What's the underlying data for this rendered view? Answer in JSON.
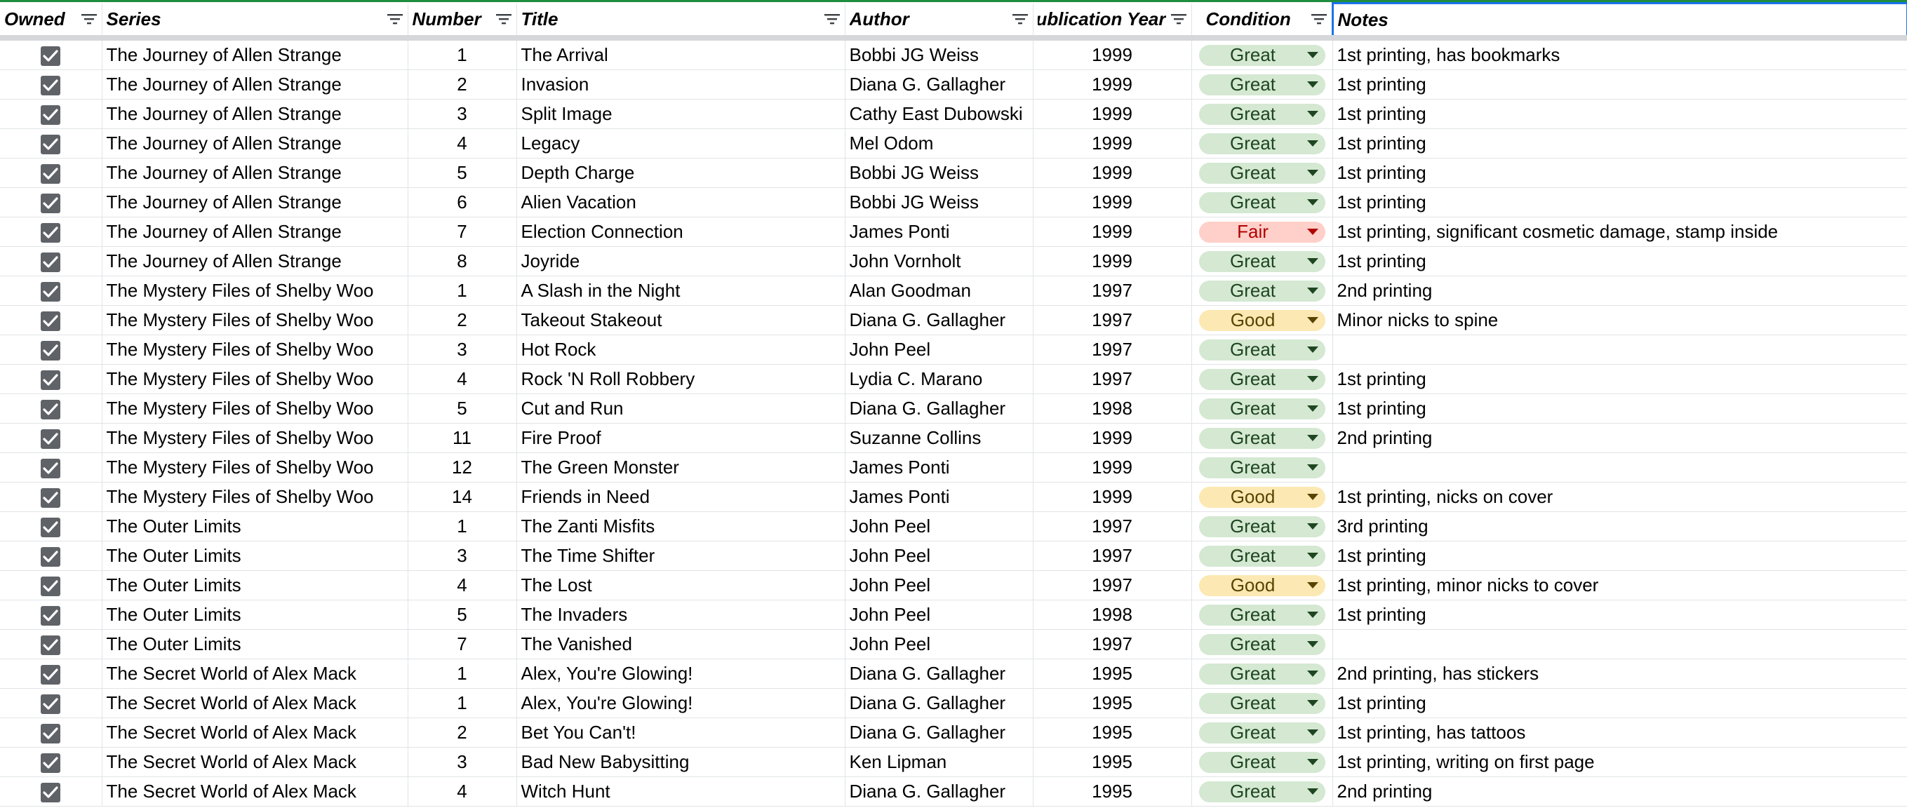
{
  "headers": {
    "owned": "Owned",
    "series": "Series",
    "number": "Number",
    "title": "Title",
    "author": "Author",
    "year": "Publication Year",
    "condition": "Condition",
    "notes": "Notes"
  },
  "condition_colors": {
    "Great": {
      "bg": "#d4e8d2",
      "fg": "#1e4620"
    },
    "Good": {
      "bg": "#fce8b2",
      "fg": "#594300"
    },
    "Fair": {
      "bg": "#ffcfc9",
      "fg": "#b10202"
    }
  },
  "rows": [
    {
      "owned": true,
      "series": "The Journey of Allen Strange",
      "number": "1",
      "title": "The Arrival",
      "author": "Bobbi JG Weiss",
      "year": "1999",
      "condition": "Great",
      "notes": "1st printing, has bookmarks"
    },
    {
      "owned": true,
      "series": "The Journey of Allen Strange",
      "number": "2",
      "title": "Invasion",
      "author": "Diana G. Gallagher",
      "year": "1999",
      "condition": "Great",
      "notes": "1st printing"
    },
    {
      "owned": true,
      "series": "The Journey of Allen Strange",
      "number": "3",
      "title": "Split Image",
      "author": "Cathy East Dubowski",
      "year": "1999",
      "condition": "Great",
      "notes": "1st printing"
    },
    {
      "owned": true,
      "series": "The Journey of Allen Strange",
      "number": "4",
      "title": "Legacy",
      "author": "Mel Odom",
      "year": "1999",
      "condition": "Great",
      "notes": "1st printing"
    },
    {
      "owned": true,
      "series": "The Journey of Allen Strange",
      "number": "5",
      "title": "Depth Charge",
      "author": "Bobbi JG Weiss",
      "year": "1999",
      "condition": "Great",
      "notes": "1st printing"
    },
    {
      "owned": true,
      "series": "The Journey of Allen Strange",
      "number": "6",
      "title": "Alien Vacation",
      "author": "Bobbi JG Weiss",
      "year": "1999",
      "condition": "Great",
      "notes": "1st printing"
    },
    {
      "owned": true,
      "series": "The Journey of Allen Strange",
      "number": "7",
      "title": "Election Connection",
      "author": "James Ponti",
      "year": "1999",
      "condition": "Fair",
      "notes": "1st printing, significant cosmetic damage, stamp inside"
    },
    {
      "owned": true,
      "series": "The Journey of Allen Strange",
      "number": "8",
      "title": "Joyride",
      "author": "John Vornholt",
      "year": "1999",
      "condition": "Great",
      "notes": "1st printing"
    },
    {
      "owned": true,
      "series": "The Mystery Files of Shelby Woo",
      "number": "1",
      "title": "A Slash in the Night",
      "author": "Alan Goodman",
      "year": "1997",
      "condition": "Great",
      "notes": "2nd printing"
    },
    {
      "owned": true,
      "series": "The Mystery Files of Shelby Woo",
      "number": "2",
      "title": "Takeout Stakeout",
      "author": "Diana G. Gallagher",
      "year": "1997",
      "condition": "Good",
      "notes": "Minor nicks to spine"
    },
    {
      "owned": true,
      "series": "The Mystery Files of Shelby Woo",
      "number": "3",
      "title": "Hot Rock",
      "author": "John Peel",
      "year": "1997",
      "condition": "Great",
      "notes": ""
    },
    {
      "owned": true,
      "series": "The Mystery Files of Shelby Woo",
      "number": "4",
      "title": "Rock 'N Roll Robbery",
      "author": "Lydia C. Marano",
      "year": "1997",
      "condition": "Great",
      "notes": "1st printing"
    },
    {
      "owned": true,
      "series": "The Mystery Files of Shelby Woo",
      "number": "5",
      "title": "Cut and Run",
      "author": "Diana G. Gallagher",
      "year": "1998",
      "condition": "Great",
      "notes": "1st printing"
    },
    {
      "owned": true,
      "series": "The Mystery Files of Shelby Woo",
      "number": "11",
      "title": "Fire Proof",
      "author": "Suzanne Collins",
      "year": "1999",
      "condition": "Great",
      "notes": "2nd printing"
    },
    {
      "owned": true,
      "series": "The Mystery Files of Shelby Woo",
      "number": "12",
      "title": "The Green Monster",
      "author": "James Ponti",
      "year": "1999",
      "condition": "Great",
      "notes": ""
    },
    {
      "owned": true,
      "series": "The Mystery Files of Shelby Woo",
      "number": "14",
      "title": "Friends in Need",
      "author": "James Ponti",
      "year": "1999",
      "condition": "Good",
      "notes": "1st printing, nicks on cover"
    },
    {
      "owned": true,
      "series": "The Outer Limits",
      "number": "1",
      "title": "The Zanti Misfits",
      "author": "John Peel",
      "year": "1997",
      "condition": "Great",
      "notes": "3rd printing"
    },
    {
      "owned": true,
      "series": "The Outer Limits",
      "number": "3",
      "title": "The Time Shifter",
      "author": "John Peel",
      "year": "1997",
      "condition": "Great",
      "notes": "1st printing"
    },
    {
      "owned": true,
      "series": "The Outer Limits",
      "number": "4",
      "title": "The Lost",
      "author": "John Peel",
      "year": "1997",
      "condition": "Good",
      "notes": "1st printing, minor nicks to cover"
    },
    {
      "owned": true,
      "series": "The Outer Limits",
      "number": "5",
      "title": "The Invaders",
      "author": "John Peel",
      "year": "1998",
      "condition": "Great",
      "notes": "1st printing"
    },
    {
      "owned": true,
      "series": "The Outer Limits",
      "number": "7",
      "title": "The Vanished",
      "author": "John Peel",
      "year": "1997",
      "condition": "Great",
      "notes": ""
    },
    {
      "owned": true,
      "series": "The Secret World of Alex Mack",
      "number": "1",
      "title": "Alex, You're Glowing!",
      "author": "Diana G. Gallagher",
      "year": "1995",
      "condition": "Great",
      "notes": "2nd printing, has stickers"
    },
    {
      "owned": true,
      "series": "The Secret World of Alex Mack",
      "number": "1",
      "title": "Alex, You're Glowing!",
      "author": "Diana G. Gallagher",
      "year": "1995",
      "condition": "Great",
      "notes": "1st printing"
    },
    {
      "owned": true,
      "series": "The Secret World of Alex Mack",
      "number": "2",
      "title": "Bet You Can't!",
      "author": "Diana G. Gallagher",
      "year": "1995",
      "condition": "Great",
      "notes": "1st printing, has tattoos"
    },
    {
      "owned": true,
      "series": "The Secret World of Alex Mack",
      "number": "3",
      "title": "Bad New Babysitting",
      "author": "Ken Lipman",
      "year": "1995",
      "condition": "Great",
      "notes": "1st printing, writing on first page"
    },
    {
      "owned": true,
      "series": "The Secret World of Alex Mack",
      "number": "4",
      "title": "Witch Hunt",
      "author": "Diana G. Gallagher",
      "year": "1995",
      "condition": "Great",
      "notes": "2nd printing"
    }
  ]
}
